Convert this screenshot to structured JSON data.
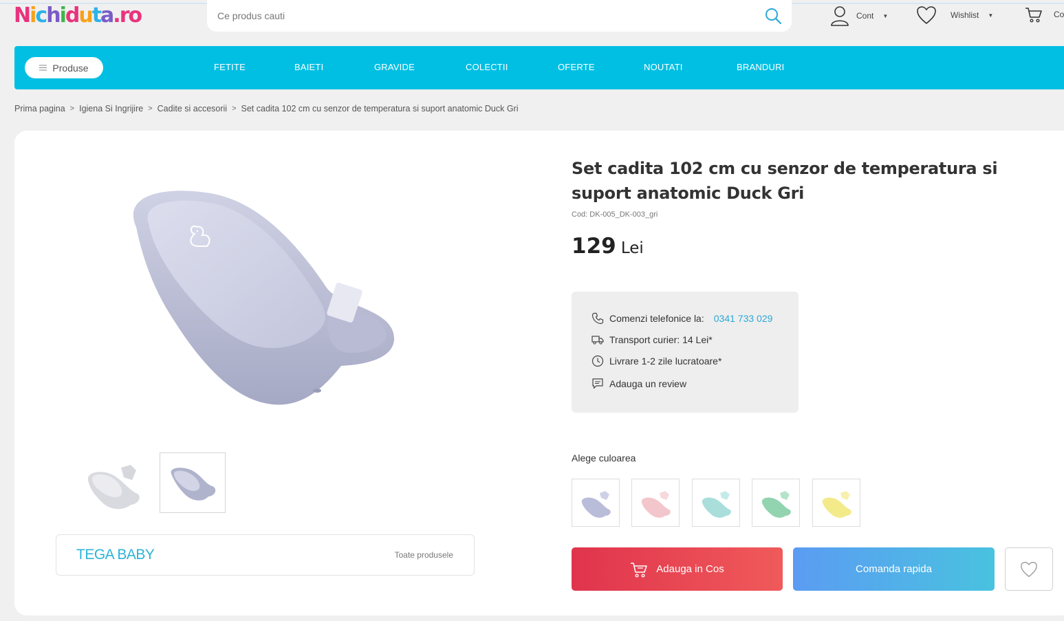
{
  "header": {
    "logo_text": "Nichiduta.ro",
    "search_placeholder": "Ce produs cauti",
    "account_label": "Cont",
    "wishlist_label": "Wishlist",
    "cart_label": "Co"
  },
  "nav": {
    "products_button": "Produse",
    "links": [
      "FETITE",
      "BAIETI",
      "GRAVIDE",
      "COLECTII",
      "OFERTE",
      "NOUTATI",
      "BRANDURI"
    ]
  },
  "breadcrumb": [
    "Prima pagina",
    "Igiena Si Ingrijire",
    "Cadite si accesorii",
    "Set cadita 102 cm cu senzor de temperatura si suport anatomic Duck Gri"
  ],
  "product": {
    "title": "Set cadita 102 cm cu senzor de temperatura si suport anatomic Duck Gri",
    "code": "Cod: DK-005_DK-003_gri",
    "price": "129",
    "currency": "Lei",
    "brand": "TEGA BABY",
    "brand_all_products": "Toate produsele"
  },
  "info": {
    "phone_label": "Comenzi telefonice la:",
    "phone_number": "0341 733 029",
    "transport": "Transport curier: 14 Lei*",
    "delivery": "Livrare 1-2 zile lucratoare*",
    "review": "Adauga un review"
  },
  "colors": {
    "label": "Alege culoarea",
    "swatches": [
      {
        "name": "gri",
        "color": "#b9bdd9"
      },
      {
        "name": "roz",
        "color": "#f3c6cc"
      },
      {
        "name": "turcoaz",
        "color": "#a9dedb"
      },
      {
        "name": "verde",
        "color": "#93d4b0"
      },
      {
        "name": "galben",
        "color": "#f3ea8a"
      }
    ]
  },
  "actions": {
    "add_to_cart": "Adauga in Cos",
    "quick_order": "Comanda rapida"
  },
  "theme": {
    "nav_color": "#00bfe3",
    "link_color": "#2aa8d8",
    "cart_button": "#e0344d",
    "quick_button": "#5b9cf2"
  },
  "icons": [
    "search-icon",
    "user-icon",
    "heart-icon",
    "cart-icon",
    "menu-icon",
    "phone-icon",
    "truck-icon",
    "clock-icon",
    "comment-icon"
  ]
}
